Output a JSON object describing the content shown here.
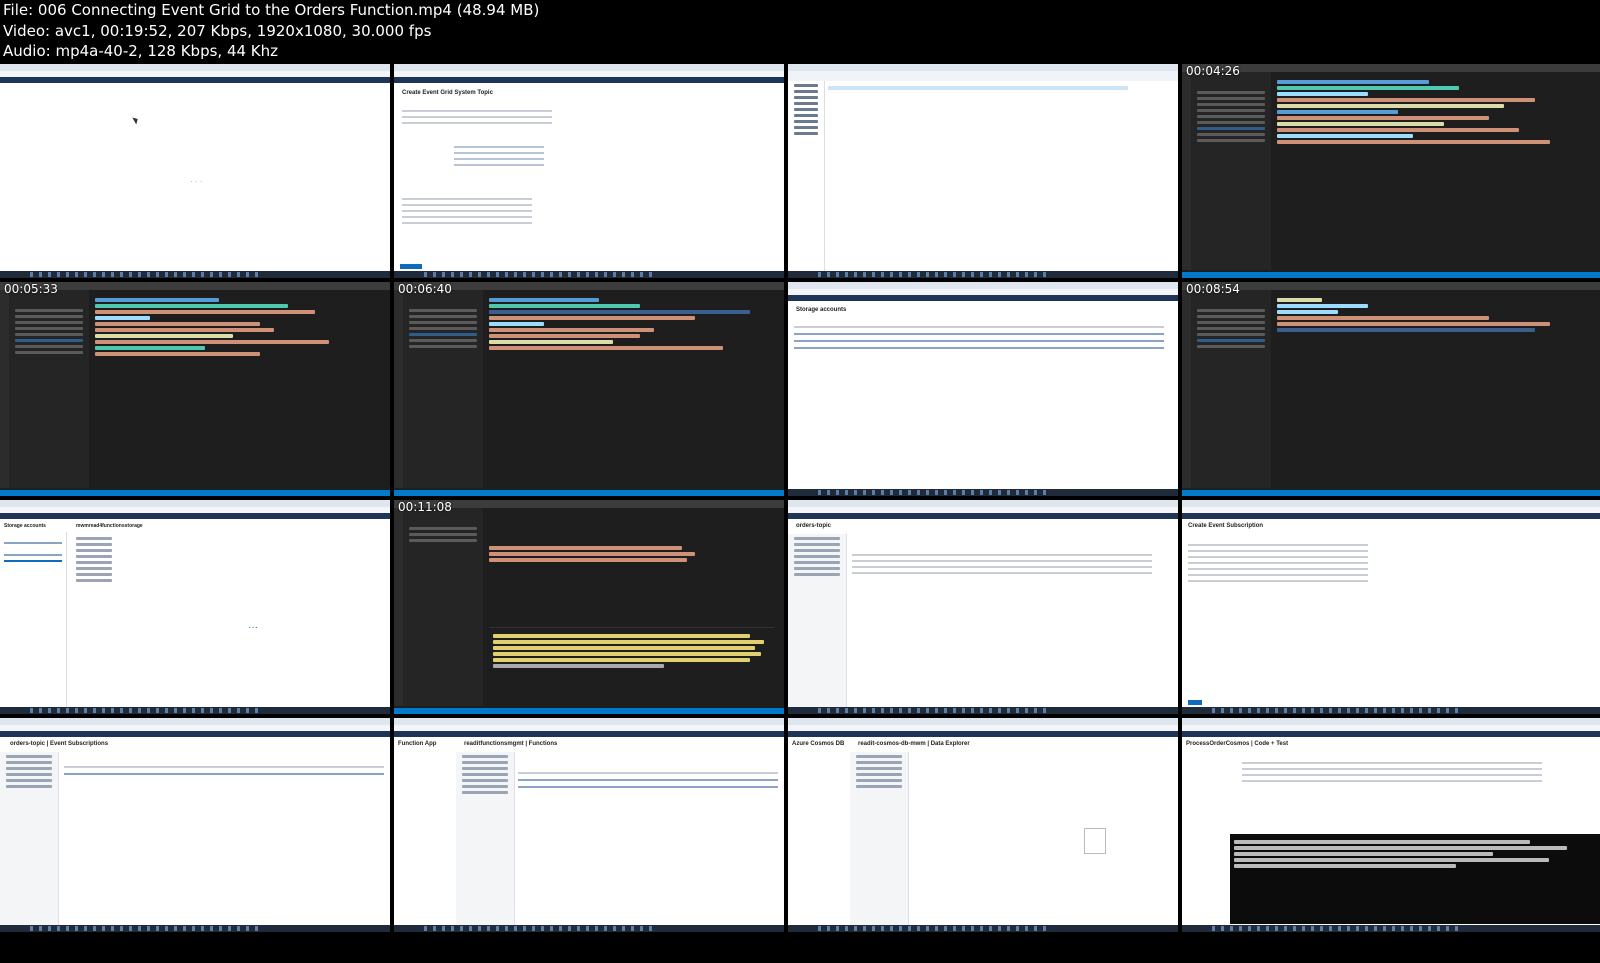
{
  "header": {
    "file_line": "File: 006 Connecting Event Grid to the Orders Function.mp4 (48.94 MB)",
    "video_line": "Video: avc1, 00:19:52, 207 Kbps, 1920x1080, 30.000 fps",
    "audio_line": "Audio: mp4a-40-2, 128 Kbps, 44 Khz"
  },
  "tiles": [
    {
      "timestamp": "",
      "title": ""
    },
    {
      "timestamp": "",
      "title": "Create Event Grid System Topic"
    },
    {
      "timestamp": "",
      "title": ""
    },
    {
      "timestamp": "00:04:26",
      "title": ""
    },
    {
      "timestamp": "00:05:33",
      "title": ""
    },
    {
      "timestamp": "00:06:40",
      "title": ""
    },
    {
      "timestamp": "",
      "title": "Storage accounts"
    },
    {
      "timestamp": "00:08:54",
      "title": ""
    },
    {
      "timestamp": "",
      "title": "Storage accounts"
    },
    {
      "timestamp": "00:11:08",
      "title": ""
    },
    {
      "timestamp": "",
      "title": "orders-topic"
    },
    {
      "timestamp": "",
      "title": "Create Event Subscription"
    },
    {
      "timestamp": "",
      "title": "orders-topic | Event Subscriptions"
    },
    {
      "timestamp": "",
      "title": "Function App"
    },
    {
      "timestamp": "",
      "title": "Azure Cosmos DB"
    },
    {
      "timestamp": "",
      "title": "ProcessOrderCosmos | Code + Test"
    }
  ],
  "tile_texts": {
    "storage_account_name": "mwmread4functionsstorage",
    "function_list_title": "readitfunctionsmgmt | Functions",
    "cosmos_title": "readit-cosmos-db-mwm | Data Explorer"
  }
}
